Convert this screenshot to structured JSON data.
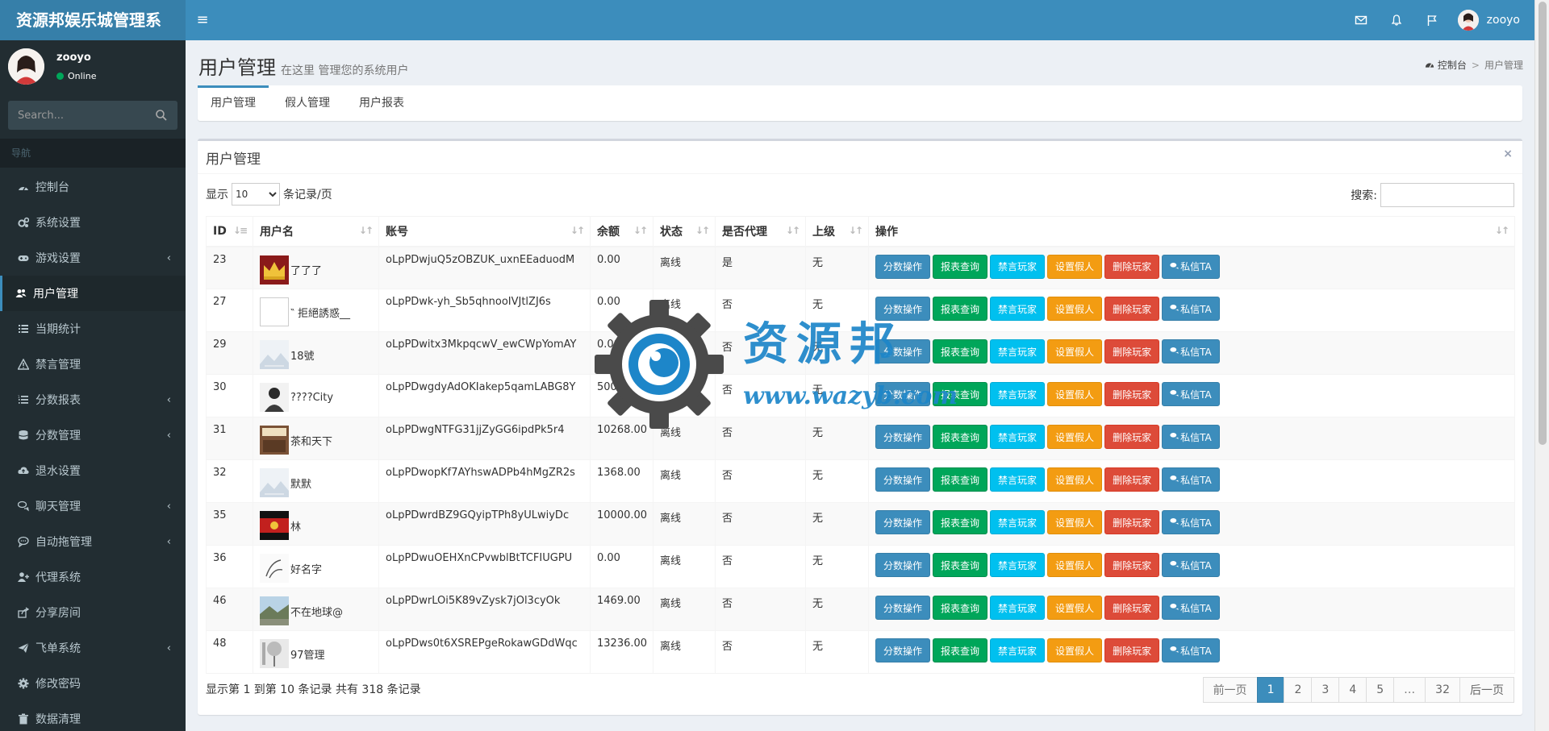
{
  "app": {
    "title": "资源邦娱乐城管理系"
  },
  "topbar": {
    "username": "zooyo"
  },
  "sidebar": {
    "username": "zooyo",
    "status": "Online",
    "search_placeholder": "Search...",
    "nav_header": "导航",
    "items": [
      {
        "label": "控制台",
        "icon": "dashboard-icon",
        "has_children": false
      },
      {
        "label": "系统设置",
        "icon": "cogs-icon",
        "has_children": false
      },
      {
        "label": "游戏设置",
        "icon": "gamepad-icon",
        "has_children": true
      },
      {
        "label": "用户管理",
        "icon": "users-icon",
        "has_children": false,
        "active": true
      },
      {
        "label": "当期统计",
        "icon": "list-icon",
        "has_children": false
      },
      {
        "label": "禁言管理",
        "icon": "warning-icon",
        "has_children": false
      },
      {
        "label": "分数报表",
        "icon": "list-ol-icon",
        "has_children": true
      },
      {
        "label": "分数管理",
        "icon": "database-icon",
        "has_children": true
      },
      {
        "label": "退水设置",
        "icon": "cloud-upload-icon",
        "has_children": false
      },
      {
        "label": "聊天管理",
        "icon": "comments-icon",
        "has_children": true
      },
      {
        "label": "自动拖管理",
        "icon": "comment-icon",
        "has_children": true
      },
      {
        "label": "代理系统",
        "icon": "user-plus-icon",
        "has_children": false
      },
      {
        "label": "分享房间",
        "icon": "share-icon",
        "has_children": false
      },
      {
        "label": "飞单系统",
        "icon": "paper-plane-icon",
        "has_children": true
      },
      {
        "label": "修改密码",
        "icon": "gear-icon",
        "has_children": false
      },
      {
        "label": "数据清理",
        "icon": "trash-icon",
        "has_children": false
      }
    ]
  },
  "page": {
    "title": "用户管理",
    "subtitle": "在这里 管理您的系统用户",
    "breadcrumb": {
      "home": "控制台",
      "current": "用户管理"
    }
  },
  "tabs": [
    {
      "label": "用户管理",
      "active": true
    },
    {
      "label": "假人管理",
      "active": false
    },
    {
      "label": "用户报表",
      "active": false
    }
  ],
  "box": {
    "title": "用户管理",
    "length_prefix": "显示",
    "length_value": "10",
    "length_suffix": "条记录/页",
    "search_label": "搜索:",
    "info": "显示第 1 到第 10 条记录 共有 318 条记录"
  },
  "table": {
    "columns": [
      "ID",
      "用户名",
      "账号",
      "余额",
      "状态",
      "是否代理",
      "上级",
      "操作"
    ],
    "actions": [
      "分数操作",
      "报表查询",
      "禁言玩家",
      "设置假人",
      "删除玩家",
      "私信TA"
    ],
    "rows": [
      {
        "id": "23",
        "name": "了了了",
        "account": "oLpPDwjuQ5zOBZUK_uxnEEaduodM",
        "balance": "0.00",
        "status": "离线",
        "agent": "是",
        "parent": "无",
        "avatar": "crown"
      },
      {
        "id": "27",
        "name": "‶ 拒絕誘惑__",
        "account": "oLpPDwk-yh_Sb5qhnooIVJtlZJ6s",
        "balance": "0.00",
        "status": "离线",
        "agent": "否",
        "parent": "无",
        "avatar": "blank"
      },
      {
        "id": "29",
        "name": "18號",
        "account": "oLpPDwitx3MkpqcwV_ewCWpYomAY",
        "balance": "0.00",
        "status": "离线",
        "agent": "否",
        "parent": "无",
        "avatar": "default"
      },
      {
        "id": "30",
        "name": "????City",
        "account": "oLpPDwgdyAdOKIakep5qamLABG8Y",
        "balance": "500.00",
        "status": "离线",
        "agent": "否",
        "parent": "无",
        "avatar": "person"
      },
      {
        "id": "31",
        "name": "茶和天下",
        "account": "oLpPDwgNTFG31jjZyGG6ipdPk5r4",
        "balance": "10268.00",
        "status": "离线",
        "agent": "否",
        "parent": "无",
        "avatar": "tea"
      },
      {
        "id": "32",
        "name": "默默",
        "account": "oLpPDwopKf7AYhswADPb4hMgZR2s",
        "balance": "1368.00",
        "status": "离线",
        "agent": "否",
        "parent": "无",
        "avatar": "default"
      },
      {
        "id": "35",
        "name": "林",
        "account": "oLpPDwrdBZ9GQyipTPh8yULwiyDc",
        "balance": "10000.00",
        "status": "离线",
        "agent": "否",
        "parent": "无",
        "avatar": "red"
      },
      {
        "id": "36",
        "name": "好名字",
        "account": "oLpPDwuOEHXnCPvwblBtTCFIUGPU",
        "balance": "0.00",
        "status": "离线",
        "agent": "否",
        "parent": "无",
        "avatar": "sketch"
      },
      {
        "id": "46",
        "name": "不在地球@",
        "account": "oLpPDwrLOi5K89vZysk7jOl3cyOk",
        "balance": "1469.00",
        "status": "离线",
        "agent": "否",
        "parent": "无",
        "avatar": "landscape"
      },
      {
        "id": "48",
        "name": "97管理",
        "account": "oLpPDws0t6XSREPgeRokawGDdWqc",
        "balance": "13236.00",
        "status": "离线",
        "agent": "否",
        "parent": "无",
        "avatar": "tree"
      }
    ]
  },
  "pagination": {
    "prev": "前一页",
    "pages": [
      "1",
      "2",
      "3",
      "4",
      "5",
      "…",
      "32"
    ],
    "current": "1",
    "next": "后一页"
  },
  "watermark": {
    "text": "资源邦",
    "url": "www.wazyb.com"
  },
  "colors": {
    "primary": "#3c8dbc",
    "sidebar": "#222d32",
    "success": "#00a65a",
    "info": "#00c0ef",
    "warning": "#f39c12",
    "danger": "#dd4b39"
  }
}
